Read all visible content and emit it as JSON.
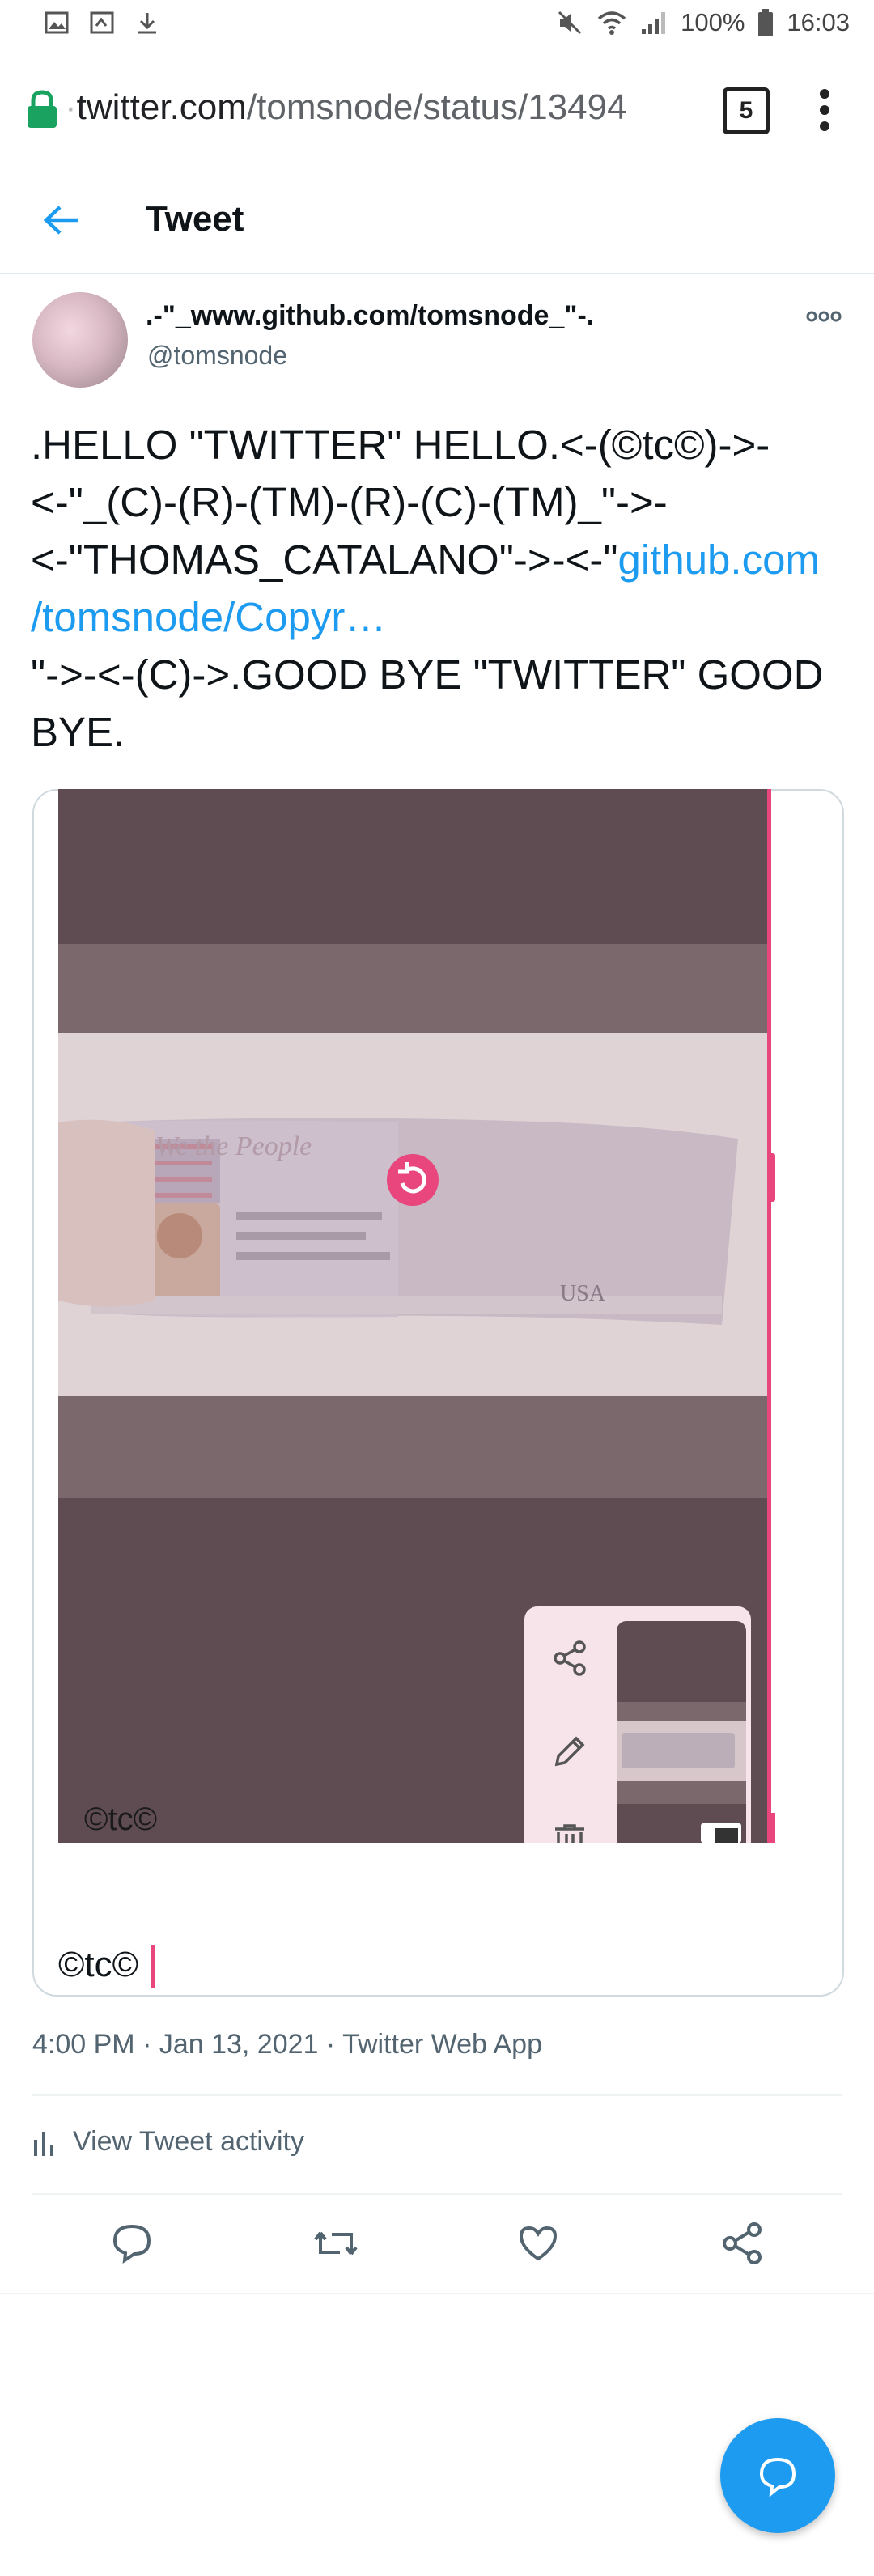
{
  "status_bar": {
    "battery": "100%",
    "time": "16:03"
  },
  "browser": {
    "url_prefix": "·",
    "url_host": "twitter.com",
    "url_path": "/tomsnode/status/13494",
    "tab_count": "5"
  },
  "header": {
    "title": "Tweet"
  },
  "tweet": {
    "author_name": ".-\"_www.github.com/tomsnode_\"-.",
    "author_handle": "@tomsnode",
    "text_lines": [
      ".HELLO \"TWITTER\" HELLO.<-(©tc©)->-",
      "<-\"_(C)-(R)-(TM)-(R)-(C)-(TM)_\"->-",
      "<-\"THOMAS_CATALANO\"->-<-\""
    ],
    "link_part1": "github.com",
    "link_part2": "/tomsnode/Copyr…",
    "text_tail_1": "\"->-<-(C)->.GOOD BYE \"TWITTER\" GOOD",
    "text_tail_2": "BYE.",
    "media_watermark": "©tc©",
    "caption": "©tc©",
    "timestamp": "4:00 PM · Jan 13, 2021",
    "source": "Twitter Web App",
    "activity_label": "View Tweet activity"
  },
  "colors": {
    "accent": "#1d9bf0",
    "pink": "#e8467c",
    "secondary_text": "#536471"
  },
  "icons": [
    "gallery-icon",
    "screenshot-icon",
    "download-icon",
    "mute-icon",
    "wifi-icon",
    "signal-icon",
    "battery-icon",
    "lock-icon",
    "tabs-icon",
    "menu-icon",
    "back-arrow-icon",
    "more-icon",
    "rotate-icon",
    "share-icon",
    "edit-icon",
    "delete-icon",
    "reply-icon",
    "retweet-icon",
    "like-icon",
    "share-tweet-icon",
    "activity-icon",
    "compose-message-icon"
  ]
}
